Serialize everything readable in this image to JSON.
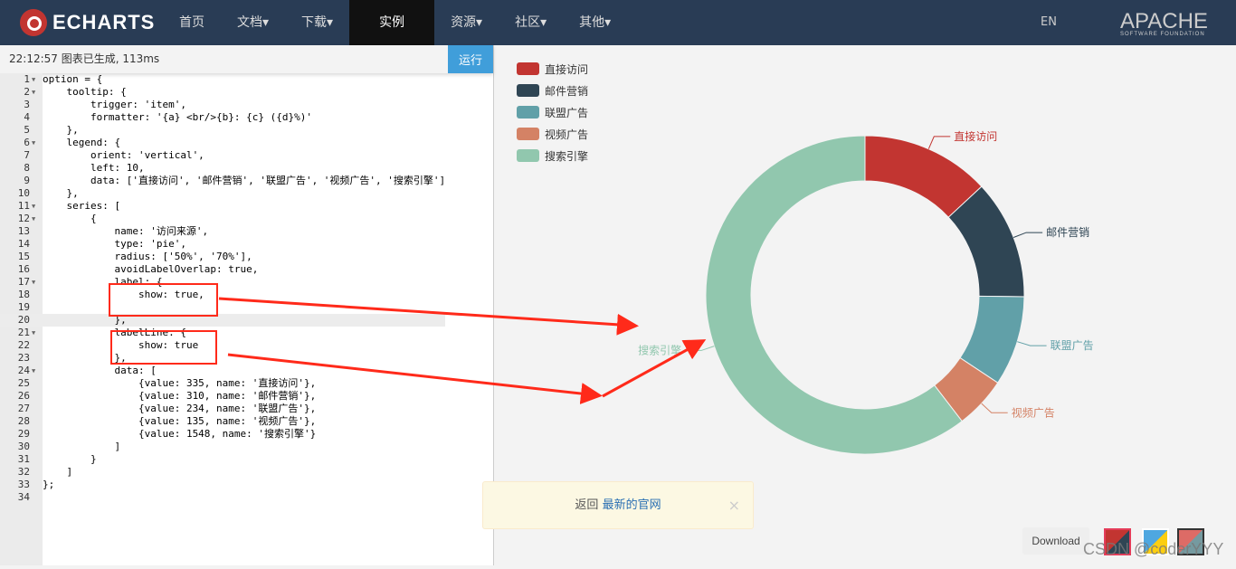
{
  "nav": {
    "logo": "ECHARTS",
    "items": [
      "首页",
      "文档▾",
      "下载▾",
      "实例",
      "资源▾",
      "社区▾",
      "其他▾"
    ],
    "active": 3,
    "lang": "EN",
    "apache": "APACHE",
    "apache_sub": "SOFTWARE FOUNDATION"
  },
  "editor": {
    "status": "22:12:57   图表已生成, 113ms",
    "run_label": "运行",
    "lines": [
      "option = {",
      "    tooltip: {",
      "        trigger: 'item',",
      "        formatter: '{a} <br/>{b}: {c} ({d}%)'",
      "    },",
      "    legend: {",
      "        orient: 'vertical',",
      "        left: 10,",
      "        data: ['直接访问', '邮件营销', '联盟广告', '视频广告', '搜索引擎']",
      "    },",
      "    series: [",
      "        {",
      "            name: '访问来源',",
      "            type: 'pie',",
      "            radius: ['50%', '70%'],",
      "            avoidLabelOverlap: true,",
      "            label: {",
      "                show: true,",
      "",
      "            },",
      "            labelLine: {",
      "                show: true",
      "            },",
      "            data: [",
      "                {value: 335, name: '直接访问'},",
      "                {value: 310, name: '邮件营销'},",
      "                {value: 234, name: '联盟广告'},",
      "                {value: 135, name: '视频广告'},",
      "                {value: 1548, name: '搜索引擎'}",
      "            ]",
      "        }",
      "    ]",
      "};",
      ""
    ],
    "foldable": [
      1,
      2,
      6,
      11,
      12,
      17,
      21,
      24
    ],
    "highlight_line": 20
  },
  "chart_data": {
    "type": "pie",
    "series_name": "访问来源",
    "radius": [
      "50%",
      "70%"
    ],
    "legend_orient": "vertical",
    "legend_placement": "top-left",
    "categories": [
      "直接访问",
      "邮件营销",
      "联盟广告",
      "视频广告",
      "搜索引擎"
    ],
    "values": [
      335,
      310,
      234,
      135,
      1548
    ],
    "colors": [
      "#c23531",
      "#2f4554",
      "#61a0a8",
      "#d48265",
      "#91c7ae"
    ]
  },
  "toast": {
    "prefix": "返回 ",
    "link": "最新的官网",
    "close": "×"
  },
  "download": "Download",
  "watermark": "CSDN @coderYYY",
  "annotation_color": "#ff2a1a"
}
